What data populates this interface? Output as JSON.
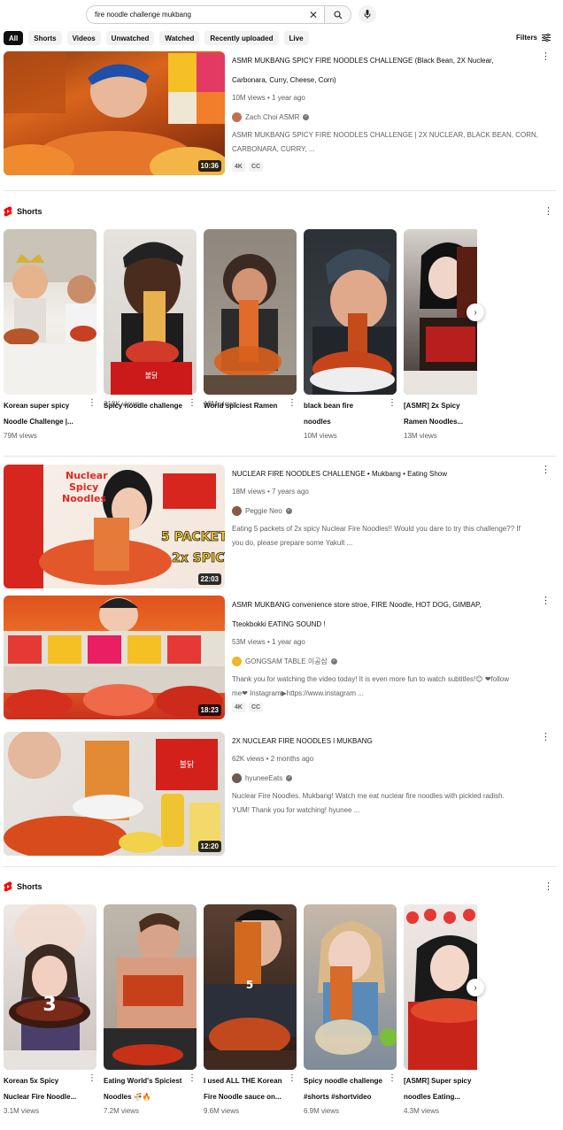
{
  "search": {
    "query": "fire noodle challenge mukbang"
  },
  "chips": [
    "All",
    "Shorts",
    "Videos",
    "Unwatched",
    "Watched",
    "Recently uploaded",
    "Live"
  ],
  "filters_label": "Filters",
  "videos": [
    {
      "title_line1": "ASMR MUKBANG SPICY FIRE NOODLES CHALLENGE (Black Bean, 2X Nuclear,",
      "title_line2": "Carbonara, Curry, Cheese, Corn)",
      "meta": "10M views • 1 year ago",
      "channel": "Zach Choi ASMR",
      "desc_line1": "ASMR MUKBANG SPICY FIRE NOODLES CHALLENGE | 2X NUCLEAR, BLACK BEAN, CORN,",
      "desc_line2": "CARBONARA, CURRY, ...",
      "badges": [
        "4K",
        "CC"
      ],
      "duration": "10:36"
    },
    {
      "title_line1": "NUCLEAR FIRE NOODLES CHALLENGE • Mukbang • Eating Show",
      "meta": "18M views • 7 years ago",
      "channel": "Peggie Neo",
      "desc_line1": "Eating 5 packets of 2x spicy Nuclear Fire Noodles!! Would you dare to try this challenge?? If",
      "desc_line2": "you do, please prepare some Yakult ...",
      "duration": "22:03",
      "thumb_text_1": "Nuclear",
      "thumb_text_2": "Spicy",
      "thumb_text_3": "Noodles",
      "thumb_text_4": "5 PACKETS",
      "thumb_text_5": "2x SPICY"
    },
    {
      "title_line1": "ASMR MUKBANG convenience store stroe, FIRE Noodle, HOT DOG, GIMBAP,",
      "title_line2": "Tteokbokki EATING SOUND !",
      "meta": "53M views • 1 year ago",
      "channel": "GONGSAM TABLE 이공삼",
      "desc_line1": "Thank you for watching the video today! It is even more fun to watch subtitles!😊 ❤follow",
      "desc_line2": "me❤ Instagram▶https://www.instagram ...",
      "badges": [
        "4K",
        "CC"
      ],
      "duration": "18:23"
    },
    {
      "title_line1": "2X NUCLEAR FIRE NOODLES l MUKBANG",
      "meta": "62K views • 2 months ago",
      "channel": "hyuneeEats",
      "desc_line1": "Nuclear Fire Noodles. Mukbang! Watch me eat nuclear fire noodles with pickled radish.",
      "desc_line2": "YUM! Thank you for watching! hyunee ...",
      "duration": "12:20"
    }
  ],
  "shelves": [
    {
      "label": "Shorts",
      "items": [
        {
          "title_line1": "Korean super spicy",
          "title_line2": "Noodle Challenge |...",
          "views": "79M views"
        },
        {
          "title_line1": "Spicy noodle challenge",
          "title_line2": "",
          "views": "318K views"
        },
        {
          "title_line1": "World spiciest Ramen",
          "title_line2": "",
          "views": "19M views"
        },
        {
          "title_line1": "black bean fire",
          "title_line2": "noodles",
          "views": "10M views"
        },
        {
          "title_line1": "[ASMR] 2x Spicy",
          "title_line2": "Ramen Noodles...",
          "views": "13M views"
        }
      ]
    },
    {
      "label": "Shorts",
      "items": [
        {
          "title_line1": "Korean 5x Spicy",
          "title_line2": "Nuclear Fire Noodle...",
          "views": "3.1M views",
          "overlay": "3"
        },
        {
          "title_line1": "Eating World's Spiciest",
          "title_line2": "Noodles 🍜🔥",
          "views": "7.2M views"
        },
        {
          "title_line1": "I used ALL THE Korean",
          "title_line2": "Fire Noodle sauce on...",
          "views": "9.6M views",
          "overlay": "5"
        },
        {
          "title_line1": "Spicy noodle challenge",
          "title_line2": "#shorts #shortvideo",
          "views": "6.9M views"
        },
        {
          "title_line1": "[ASMR] Super spicy",
          "title_line2": "noodles Eating...",
          "views": "4.3M views"
        }
      ]
    }
  ],
  "icons": {
    "search": "search-icon",
    "clear": "close-icon",
    "mic": "mic-icon",
    "filters": "filters-icon",
    "more": "more-vert-icon",
    "shorts": "shorts-logo-icon",
    "next": "chevron-right-icon",
    "verified": "verified-icon"
  },
  "colors": {
    "accent": "#ff0000",
    "chip_active": "#0f0f0f",
    "chip_bg": "#f2f2f2",
    "meta_text": "#606060"
  }
}
